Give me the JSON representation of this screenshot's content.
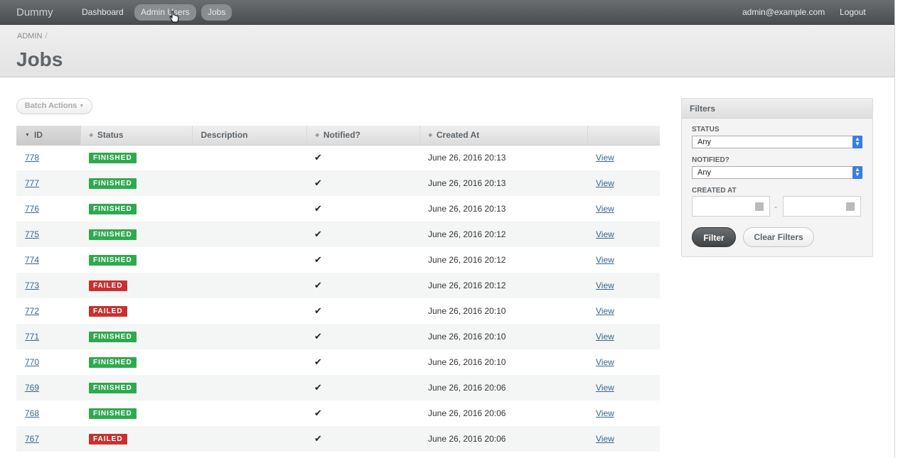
{
  "header": {
    "brand": "Dummy",
    "nav": [
      "Dashboard",
      "Admin Users",
      "Jobs"
    ],
    "user_email": "admin@example.com",
    "logout": "Logout"
  },
  "title_bar": {
    "breadcrumb": "ADMIN",
    "breadcrumb_sep": "/",
    "title": "Jobs"
  },
  "batch_actions": "Batch Actions",
  "table": {
    "columns": [
      "ID",
      "Status",
      "Description",
      "Notified?",
      "Created At",
      ""
    ],
    "rows": [
      {
        "id": "778",
        "status": "FINISHED",
        "description": "",
        "notified": "✔",
        "created_at": "June 26, 2016 20:13",
        "action": "View"
      },
      {
        "id": "777",
        "status": "FINISHED",
        "description": "",
        "notified": "✔",
        "created_at": "June 26, 2016 20:13",
        "action": "View"
      },
      {
        "id": "776",
        "status": "FINISHED",
        "description": "",
        "notified": "✔",
        "created_at": "June 26, 2016 20:13",
        "action": "View"
      },
      {
        "id": "775",
        "status": "FINISHED",
        "description": "",
        "notified": "✔",
        "created_at": "June 26, 2016 20:12",
        "action": "View"
      },
      {
        "id": "774",
        "status": "FINISHED",
        "description": "",
        "notified": "✔",
        "created_at": "June 26, 2016 20:12",
        "action": "View"
      },
      {
        "id": "773",
        "status": "FAILED",
        "description": "",
        "notified": "✔",
        "created_at": "June 26, 2016 20:12",
        "action": "View"
      },
      {
        "id": "772",
        "status": "FAILED",
        "description": "",
        "notified": "✔",
        "created_at": "June 26, 2016 20:10",
        "action": "View"
      },
      {
        "id": "771",
        "status": "FINISHED",
        "description": "",
        "notified": "✔",
        "created_at": "June 26, 2016 20:10",
        "action": "View"
      },
      {
        "id": "770",
        "status": "FINISHED",
        "description": "",
        "notified": "✔",
        "created_at": "June 26, 2016 20:10",
        "action": "View"
      },
      {
        "id": "769",
        "status": "FINISHED",
        "description": "",
        "notified": "✔",
        "created_at": "June 26, 2016 20:06",
        "action": "View"
      },
      {
        "id": "768",
        "status": "FINISHED",
        "description": "",
        "notified": "✔",
        "created_at": "June 26, 2016 20:06",
        "action": "View"
      },
      {
        "id": "767",
        "status": "FAILED",
        "description": "",
        "notified": "✔",
        "created_at": "June 26, 2016 20:06",
        "action": "View"
      }
    ]
  },
  "filters": {
    "title": "Filters",
    "status_label": "STATUS",
    "status_value": "Any",
    "notified_label": "NOTIFIED?",
    "notified_value": "Any",
    "created_at_label": "CREATED AT",
    "date_sep": "-",
    "filter_button": "Filter",
    "clear_button": "Clear Filters"
  },
  "colors": {
    "finished": "#2fa94e",
    "failed": "#c93030",
    "link": "#38678b"
  }
}
